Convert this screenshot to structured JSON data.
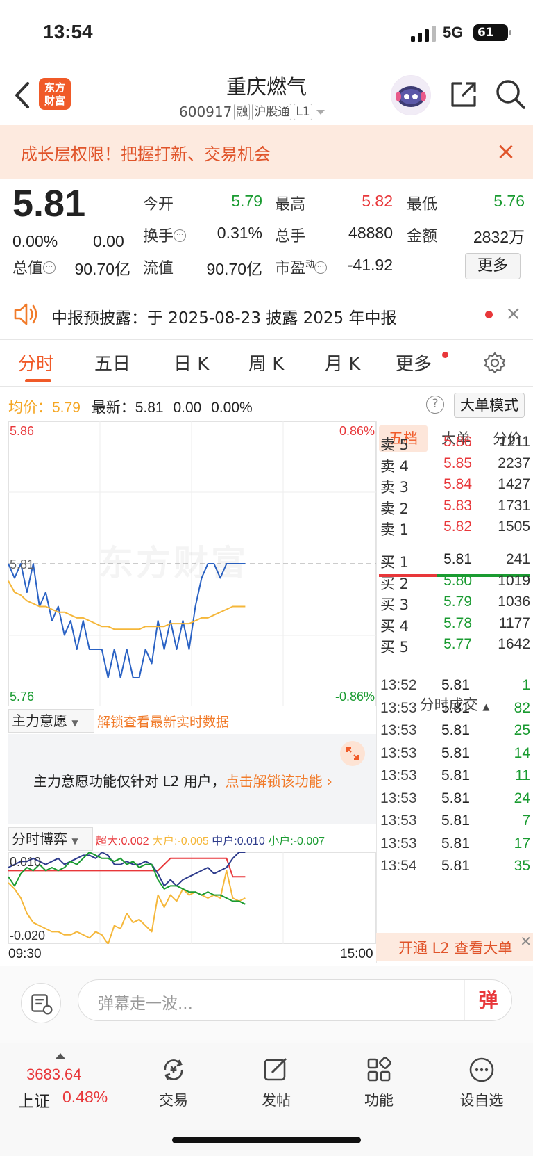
{
  "status_bar": {
    "time": "13:54",
    "network": "5G",
    "battery": "61"
  },
  "header": {
    "logo_line1": "东方",
    "logo_line2": "财富",
    "stock_name": "重庆燃气",
    "stock_code": "600917",
    "tags": [
      "融",
      "沪股通",
      "L1"
    ]
  },
  "banner": {
    "text": "成长层权限！把握打新、交易机会"
  },
  "quote": {
    "price": "5.81",
    "change_pct": "0.00%",
    "change": "0.00",
    "fields": [
      {
        "label": "今开",
        "value": "5.79",
        "color": "#1a9b31"
      },
      {
        "label": "最高",
        "value": "5.82",
        "color": "#e8373a"
      },
      {
        "label": "最低",
        "value": "5.76",
        "color": "#1a9b31"
      },
      {
        "label": "换手",
        "value": "0.31%",
        "color": "#222222"
      },
      {
        "label": "总手",
        "value": "48880",
        "color": "#222222"
      },
      {
        "label": "金额",
        "value": "2832万",
        "color": "#222222"
      },
      {
        "label": "总值",
        "value": "90.70亿",
        "color": "#222222"
      },
      {
        "label": "流值",
        "value": "90.70亿",
        "color": "#222222"
      },
      {
        "label": "市盈",
        "sup": "动",
        "value": "-41.92",
        "color": "#222222"
      }
    ],
    "more_label": "更多"
  },
  "notice": {
    "text": "中报预披露：于 2025-08-23 披露 2025 年中报"
  },
  "tabs": [
    "分时",
    "五日",
    "日 K",
    "周 K",
    "月 K",
    "更多"
  ],
  "info_row": {
    "avg_label": "均价：",
    "avg_value": "5.79",
    "latest_label": "最新：",
    "latest_value": "5.81",
    "latest_change": "0.00",
    "latest_pct": "0.00%",
    "big_order_label": "大单模式"
  },
  "price_chart": {
    "y_top": "5.86",
    "y_mid": "5.81",
    "y_bottom": "5.76",
    "pct_top": "0.86%",
    "pct_bottom": "-0.86%",
    "watermark": "东方财富"
  },
  "chart_data": [
    {
      "type": "line",
      "ylim": [
        5.76,
        5.86
      ],
      "series": [
        {
          "values": [
            5.81,
            5.805,
            5.81,
            5.8,
            5.81,
            5.795,
            5.8,
            5.79,
            5.795,
            5.785,
            5.79,
            5.78,
            5.79,
            5.78,
            5.78,
            5.78,
            5.77,
            5.78,
            5.77,
            5.78,
            5.77,
            5.77,
            5.78,
            5.775,
            5.79,
            5.78,
            5.79,
            5.78,
            5.79,
            5.78,
            5.795,
            5.805,
            5.81,
            5.81,
            5.805,
            5.81,
            5.81,
            5.81,
            5.81
          ],
          "color": "#2a62c4"
        },
        {
          "values": [
            5.804,
            5.8,
            5.799,
            5.797,
            5.796,
            5.795,
            5.795,
            5.794,
            5.793,
            5.793,
            5.792,
            5.791,
            5.791,
            5.79,
            5.789,
            5.788,
            5.788,
            5.787,
            5.787,
            5.787,
            5.787,
            5.787,
            5.788,
            5.788,
            5.788,
            5.788,
            5.789,
            5.789,
            5.789,
            5.789,
            5.79,
            5.791,
            5.791,
            5.792,
            5.793,
            5.794,
            5.795,
            5.795,
            5.795
          ],
          "color": "#f5b73a"
        }
      ]
    },
    {
      "type": "line",
      "ylim": [
        -0.02,
        0.01
      ],
      "series": [
        {
          "values": [
            0.004,
            0.004,
            0.004,
            0.004,
            0.004,
            0.004,
            0.004,
            0.004,
            0.004,
            0.004,
            0.004,
            0.004,
            0.004,
            0.004,
            0.004,
            0.004,
            0.004,
            0.004,
            0.004,
            0.004,
            0.004,
            0.004,
            0.004,
            0.004,
            0.004,
            0.006,
            0.008,
            0.008,
            0.008,
            0.008,
            0.008,
            0.008,
            0.008,
            0.008,
            0.008,
            0.008,
            0.002,
            0.002,
            0.002
          ],
          "color": "#e8373a"
        },
        {
          "values": [
            0,
            -0.002,
            -0.005,
            -0.01,
            -0.013,
            -0.014,
            -0.015,
            -0.016,
            -0.016,
            -0.017,
            -0.017,
            -0.016,
            -0.017,
            -0.018,
            -0.016,
            -0.017,
            -0.02,
            -0.014,
            -0.015,
            -0.01,
            -0.013,
            -0.012,
            -0.014,
            -0.016,
            -0.004,
            -0.008,
            -0.004,
            -0.006,
            -0.002,
            -0.004,
            -0.003,
            -0.004,
            -0.005,
            -0.004,
            -0.005,
            0.004,
            -0.005,
            -0.006,
            -0.005
          ],
          "color": "#f5b73a"
        },
        {
          "values": [
            0.005,
            0.006,
            0.007,
            0.007,
            0.008,
            0.007,
            0.006,
            0.007,
            0.008,
            0.006,
            0.007,
            0.008,
            0.009,
            0.009,
            0.008,
            0.01,
            0.009,
            0.006,
            0.006,
            0.007,
            0.006,
            0.006,
            0.007,
            0.006,
            0.003,
            -0.001,
            0.001,
            -0.001,
            0.001,
            0.002,
            0.003,
            0.004,
            0.005,
            0.003,
            0.004,
            0.005,
            0.008,
            0.01,
            0.01
          ],
          "color": "#2e3c8c"
        },
        {
          "values": [
            0.002,
            -0.001,
            0.003,
            0.005,
            0.004,
            0.006,
            0.004,
            0.005,
            0.004,
            0.005,
            0.007,
            0.006,
            0.008,
            0.01,
            0.009,
            0.008,
            0.008,
            0.007,
            0.008,
            0.006,
            0.007,
            0.005,
            0.006,
            0.006,
            0.001,
            -0.002,
            -0.001,
            -0.001,
            -0.002,
            -0.003,
            -0.003,
            -0.004,
            -0.003,
            -0.004,
            -0.004,
            -0.005,
            -0.006,
            -0.006,
            -0.007
          ],
          "color": "#1a9b31"
        }
      ]
    }
  ],
  "intent": {
    "select_label": "主力意愿",
    "unlock_link": "解锁查看最新实时数据",
    "body_text": "主力意愿功能仅针对 L2 用户，",
    "body_link": "点击解锁该功能"
  },
  "game": {
    "select_label": "分时博弈",
    "legend": [
      {
        "label": "超大:",
        "value": "0.002",
        "color": "#e8373a"
      },
      {
        "label": "大户:",
        "value": "-0.005",
        "color": "#f5b73a"
      },
      {
        "label": "中户:",
        "value": "0.010",
        "color": "#2e3c8c"
      },
      {
        "label": "小户:",
        "value": "-0.007",
        "color": "#1a9b31"
      }
    ],
    "y_top": "0.010",
    "y_bottom": "-0.020",
    "time_start": "09:30",
    "time_end": "15:00"
  },
  "order_book": {
    "tabs": [
      "五档",
      "大单",
      "分价"
    ],
    "asks": [
      {
        "label": "卖 5",
        "price": "5.86",
        "vol": "1211",
        "color": "#e8373a"
      },
      {
        "label": "卖 4",
        "price": "5.85",
        "vol": "2237",
        "color": "#e8373a"
      },
      {
        "label": "卖 3",
        "price": "5.84",
        "vol": "1427",
        "color": "#e8373a"
      },
      {
        "label": "卖 2",
        "price": "5.83",
        "vol": "1731",
        "color": "#e8373a"
      },
      {
        "label": "卖 1",
        "price": "5.82",
        "vol": "1505",
        "color": "#e8373a"
      }
    ],
    "bids": [
      {
        "label": "买 1",
        "price": "5.81",
        "vol": "241",
        "color": "#222222"
      },
      {
        "label": "买 2",
        "price": "5.80",
        "vol": "1019",
        "color": "#1a9b31"
      },
      {
        "label": "买 3",
        "price": "5.79",
        "vol": "1036",
        "color": "#1a9b31"
      },
      {
        "label": "买 4",
        "price": "5.78",
        "vol": "1177",
        "color": "#1a9b31"
      },
      {
        "label": "买 5",
        "price": "5.77",
        "vol": "1642",
        "color": "#1a9b31"
      }
    ],
    "ticks_title": "分时成交",
    "ticks": [
      {
        "time": "13:52",
        "price": "5.81",
        "vol": "1",
        "color": "#1a9b31"
      },
      {
        "time": "13:53",
        "price": "5.81",
        "vol": "82",
        "color": "#1a9b31"
      },
      {
        "time": "13:53",
        "price": "5.81",
        "vol": "25",
        "color": "#1a9b31"
      },
      {
        "time": "13:53",
        "price": "5.81",
        "vol": "14",
        "color": "#1a9b31"
      },
      {
        "time": "13:53",
        "price": "5.81",
        "vol": "11",
        "color": "#1a9b31"
      },
      {
        "time": "13:53",
        "price": "5.81",
        "vol": "24",
        "color": "#1a9b31"
      },
      {
        "time": "13:53",
        "price": "5.81",
        "vol": "7",
        "color": "#1a9b31"
      },
      {
        "time": "13:53",
        "price": "5.81",
        "vol": "17",
        "color": "#1a9b31"
      },
      {
        "time": "13:54",
        "price": "5.81",
        "vol": "35",
        "color": "#1a9b31"
      }
    ],
    "l2_promo": "开通 L2 查看大单"
  },
  "danmu": {
    "placeholder": "弹幕走一波...",
    "send_label": "弹"
  },
  "bottom_nav": {
    "index_value": "3683.64",
    "index_name": "上证",
    "index_change": "0.48%",
    "items": [
      "交易",
      "发帖",
      "功能",
      "设自选"
    ]
  }
}
